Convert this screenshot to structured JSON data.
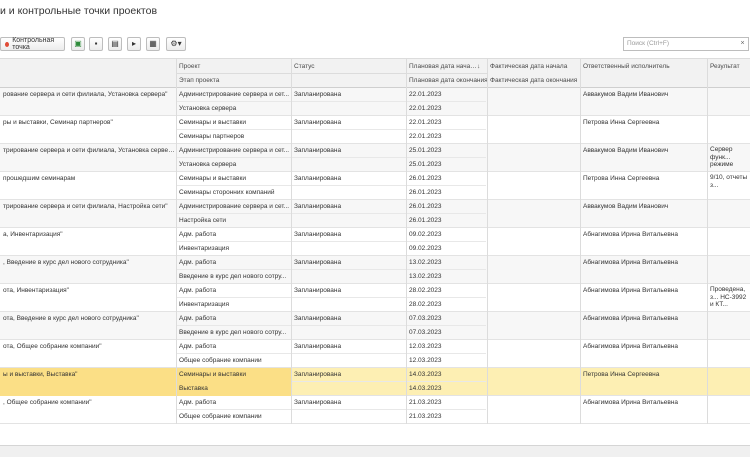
{
  "title": "и и контрольные точки проектов",
  "toolbar": {
    "control_point_label": "Контрольная точка",
    "search_placeholder": "Поиск (Ctrl+F)",
    "search_clear": "×"
  },
  "columns": {
    "project": "Проект",
    "stage": "Этап проекта",
    "status": "Статус",
    "plan_start": "Плановая дата начала",
    "plan_end": "Плановая дата окончания",
    "fact_start": "Фактическая дата начала",
    "fact_end": "Фактическая дата окончания",
    "responsible": "Ответственный исполнитель",
    "result": "Результат"
  },
  "rows": [
    {
      "name": "рование сервера и сети филиала, Установка сервера\"",
      "project": "Администрирование сервера и сет...",
      "stage": "Установка сервера",
      "status": "Запланирована",
      "plan_start": "22.01.2023",
      "plan_end": "22.01.2023",
      "responsible": "Аввакумов Вадим Иванович",
      "result": ""
    },
    {
      "name": "ры и выставки, Семинар партнеров\"",
      "project": "Семинары и выставки",
      "stage": "Семинары партнеров",
      "status": "Запланирована",
      "plan_start": "22.01.2023",
      "plan_end": "22.01.2023",
      "responsible": "Петрова Инна Сергеевна",
      "result": ""
    },
    {
      "name": "трирование сервера и сети филиала, Установка сервера\"",
      "project": "Администрирование сервера и сет...",
      "stage": "Установка сервера",
      "status": "Запланирована",
      "plan_start": "25.01.2023",
      "plan_end": "25.01.2023",
      "responsible": "Аввакумов Вадим Иванович",
      "result": "Сервер функ... режиме"
    },
    {
      "name": "прошедшим семинарам",
      "project": "Семинары и выставки",
      "stage": "Семинары сторонних компаний",
      "status": "Запланирована",
      "plan_start": "26.01.2023",
      "plan_end": "26.01.2023",
      "responsible": "Петрова Инна Сергеевна",
      "result": "9/10, отчеты з..."
    },
    {
      "name": "трирование сервера и сети филиала, Настройка сети\"",
      "project": "Администрирование сервера и сет...",
      "stage": "Настройка сети",
      "status": "Запланирована",
      "plan_start": "26.01.2023",
      "plan_end": "26.01.2023",
      "responsible": "Аввакумов Вадим Иванович",
      "result": ""
    },
    {
      "name": "а, Инвентаризация\"",
      "project": "Адм. работа",
      "stage": "Инвентаризация",
      "status": "Запланирована",
      "plan_start": "09.02.2023",
      "plan_end": "09.02.2023",
      "responsible": "Абнагимова Ирина Витальевна",
      "result": ""
    },
    {
      "name": ", Введение в курс дел нового сотрудника\"",
      "project": "Адм. работа",
      "stage": "Введение в курс дел нового сотру...",
      "status": "Запланирована",
      "plan_start": "13.02.2023",
      "plan_end": "13.02.2023",
      "responsible": "Абнагимова Ирина Витальевна",
      "result": ""
    },
    {
      "name": "ота, Инвентаризация\"",
      "project": "Адм. работа",
      "stage": "Инвентаризация",
      "status": "Запланирована",
      "plan_start": "28.02.2023",
      "plan_end": "28.02.2023",
      "responsible": "Абнагимова Ирина Витальевна",
      "result": "Проведена, з... НС-3992 и КТ..."
    },
    {
      "name": "ота, Введение в курс дел нового сотрудника\"",
      "project": "Адм. работа",
      "stage": "Введение в курс дел нового сотру...",
      "status": "Запланирована",
      "plan_start": "07.03.2023",
      "plan_end": "07.03.2023",
      "responsible": "Абнагимова Ирина Витальевна",
      "result": ""
    },
    {
      "name": "ота, Общее собрание компании\"",
      "project": "Адм. работа",
      "stage": "Общее собрание компании",
      "status": "Запланирована",
      "plan_start": "12.03.2023",
      "plan_end": "12.03.2023",
      "responsible": "Абнагимова Ирина Витальевна",
      "result": ""
    },
    {
      "name": "ы и выставки, Выставка\"",
      "project": "Семинары и выставки",
      "stage": "Выставка",
      "status": "Запланирована",
      "plan_start": "14.03.2023",
      "plan_end": "14.03.2023",
      "responsible": "Петрова Инна Сергеевна",
      "result": ""
    },
    {
      "name": ", Общее собрание компании\"",
      "project": "Адм. работа",
      "stage": "Общее собрание компании",
      "status": "Запланирована",
      "plan_start": "21.03.2023",
      "plan_end": "21.03.2023",
      "responsible": "Абнагимова Ирина Витальевна",
      "result": ""
    }
  ],
  "selected_row": 10
}
